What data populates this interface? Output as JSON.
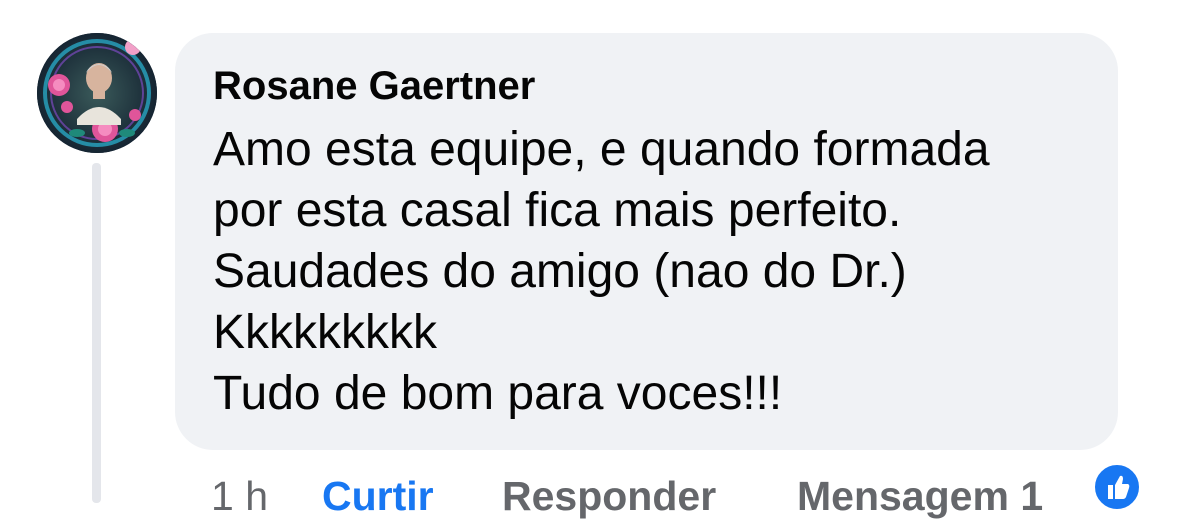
{
  "comment": {
    "author": "Rosane Gaertner",
    "lines": [
      "Amo esta equipe, e quando formada",
      "por esta casal fica mais perfeito.",
      "Saudades do amigo (nao do Dr.)",
      "Kkkkkkkkk",
      "Tudo de bom para voces!!!"
    ]
  },
  "actions": {
    "time": "1 h",
    "like": "Curtir",
    "reply": "Responder",
    "message": "Mensagem",
    "reaction_count": "1"
  },
  "icons": {
    "avatar": "profile-photo",
    "reaction": "thumbs-up-icon"
  },
  "colors": {
    "bubble": "#f0f2f5",
    "text": "#050505",
    "muted": "#65676b",
    "accent": "#1877f2"
  }
}
